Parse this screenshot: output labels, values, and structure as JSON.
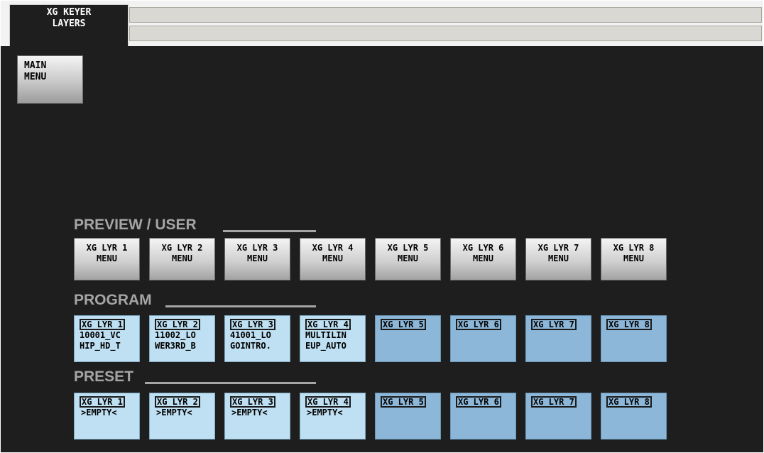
{
  "tab": {
    "line1": "XG KEYER",
    "line2": "LAYERS"
  },
  "main_menu": {
    "line1": "MAIN",
    "line2": "MENU"
  },
  "sections": {
    "preview": "PREVIEW / USER",
    "program": "PROGRAM",
    "preset": "PRESET"
  },
  "preview_buttons": [
    {
      "line1": "XG LYR 1",
      "line2": "MENU"
    },
    {
      "line1": "XG LYR 2",
      "line2": "MENU"
    },
    {
      "line1": "XG LYR 3",
      "line2": "MENU"
    },
    {
      "line1": "XG LYR 4",
      "line2": "MENU"
    },
    {
      "line1": "XG LYR 5",
      "line2": "MENU"
    },
    {
      "line1": "XG LYR 6",
      "line2": "MENU"
    },
    {
      "line1": "XG LYR 7",
      "line2": "MENU"
    },
    {
      "line1": "XG LYR 8",
      "line2": "MENU"
    }
  ],
  "program_buttons": [
    {
      "label": "XG LYR 1",
      "value1": "10001_VC",
      "value2": "HIP_HD_T"
    },
    {
      "label": "XG LYR 2",
      "value1": "11002_LO",
      "value2": "WER3RD_B"
    },
    {
      "label": "XG LYR 3",
      "value1": "41001_LO",
      "value2": "GOINTRO."
    },
    {
      "label": "XG LYR 4",
      "value1": "MULTILIN",
      "value2": "EUP_AUTO"
    },
    {
      "label": "XG LYR 5",
      "value1": "",
      "value2": ""
    },
    {
      "label": "XG LYR 6",
      "value1": "",
      "value2": ""
    },
    {
      "label": "XG LYR 7",
      "value1": "",
      "value2": ""
    },
    {
      "label": "XG LYR 8",
      "value1": "",
      "value2": ""
    }
  ],
  "preset_buttons": [
    {
      "label": "XG LYR 1",
      "value1": ">EMPTY<"
    },
    {
      "label": "XG LYR 2",
      "value1": ">EMPTY<"
    },
    {
      "label": "XG LYR 3",
      "value1": ">EMPTY<"
    },
    {
      "label": "XG LYR 4",
      "value1": ">EMPTY<"
    },
    {
      "label": "XG LYR 5",
      "value1": ""
    },
    {
      "label": "XG LYR 6",
      "value1": ""
    },
    {
      "label": "XG LYR 7",
      "value1": ""
    },
    {
      "label": "XG LYR 8",
      "value1": ""
    }
  ],
  "colors": {
    "background": "#1e1e1e",
    "button_gray": "#c8c8c8",
    "loaded_blue": "#bfe0f2",
    "empty_blue": "#8db7d8",
    "section_title": "#a5a5a5"
  }
}
